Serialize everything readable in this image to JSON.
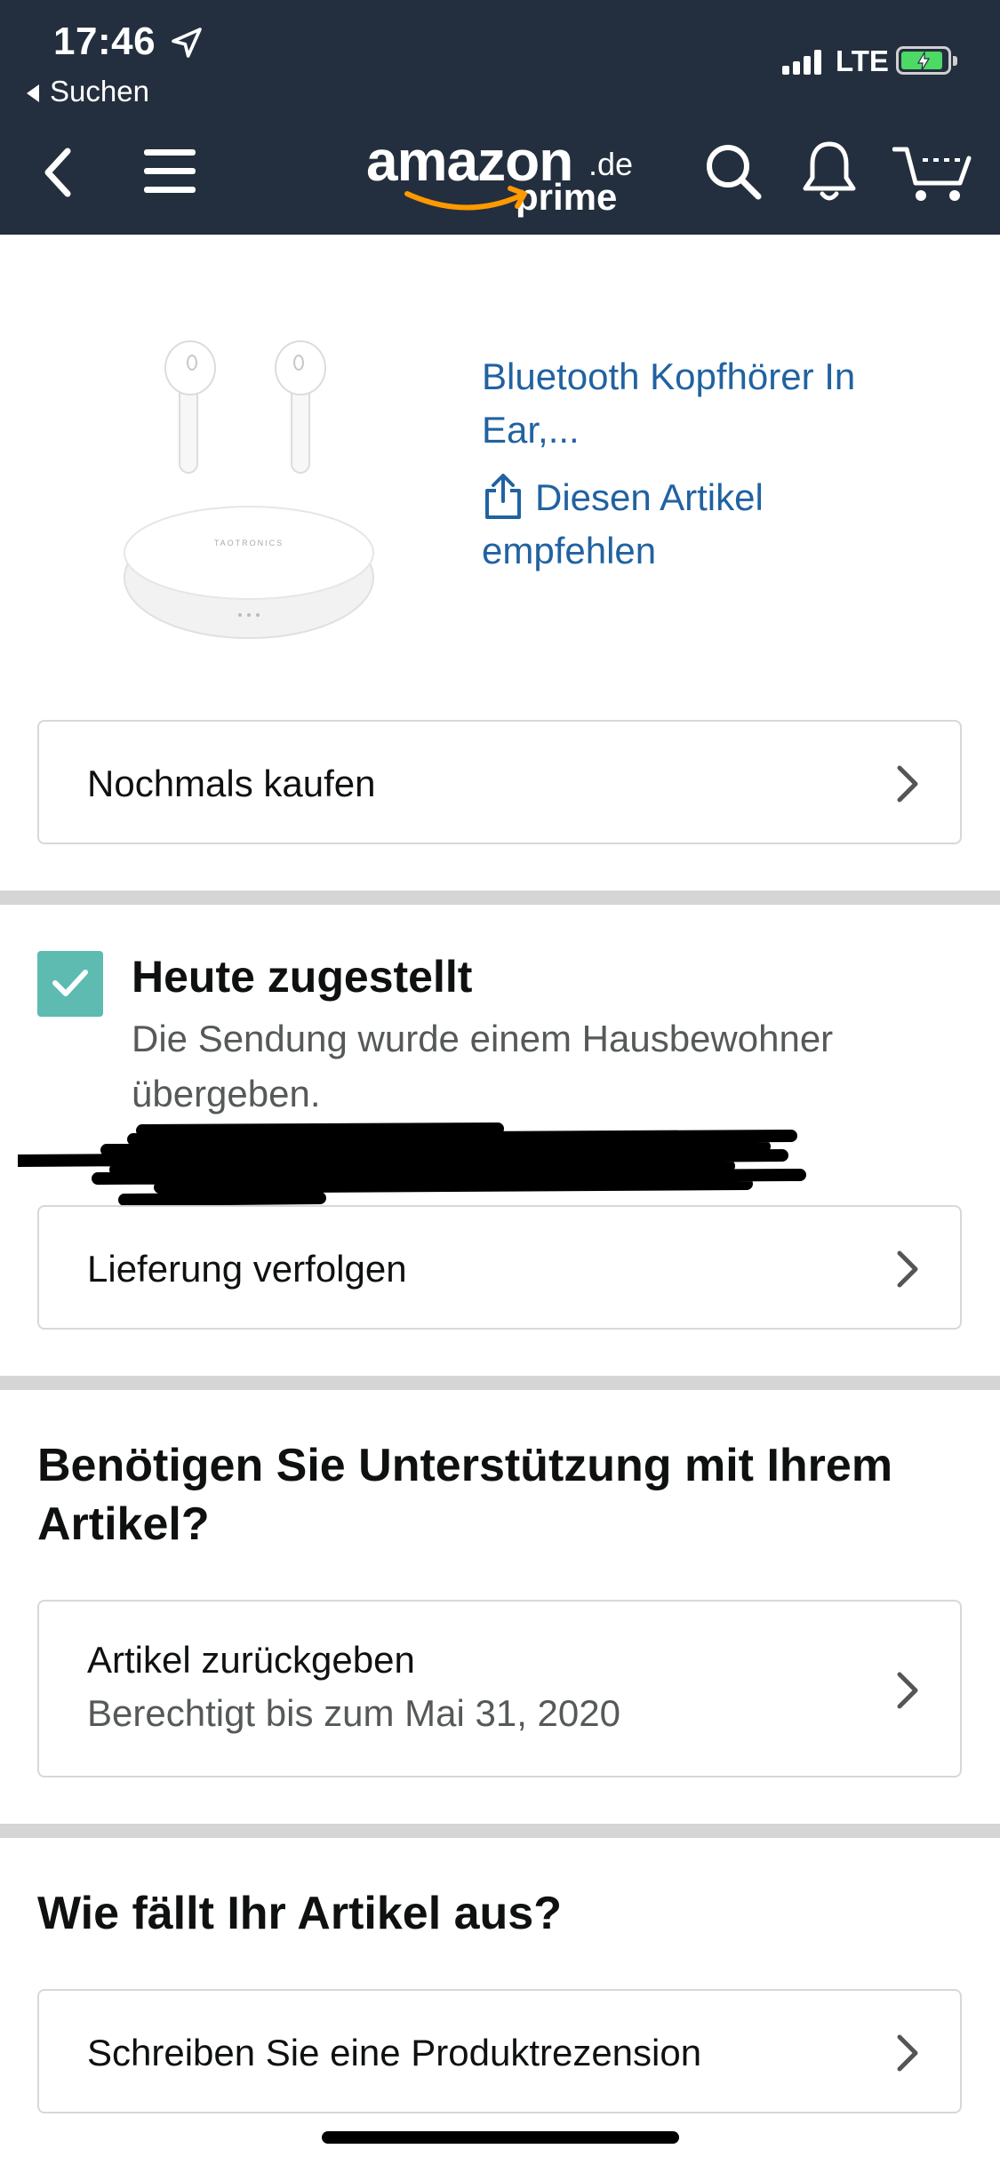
{
  "status_bar": {
    "time": "17:46",
    "back_to_app": "Suchen",
    "network": "LTE"
  },
  "nav": {
    "logo_text": "amazon",
    "logo_suffix": ".de",
    "logo_prime": "prime",
    "icons": [
      "back-icon",
      "menu-icon",
      "search-icon",
      "bell-icon",
      "cart-icon"
    ]
  },
  "product": {
    "title": "Bluetooth Kopfhörer In Ear,...",
    "recommend_label": "Diesen Artikel empfehlen",
    "buy_again_label": "Nochmals kaufen"
  },
  "delivery": {
    "status_title": "Heute zugestellt",
    "status_desc": "Die Sendung wurde einem Hausbewohner übergeben.",
    "track_label": "Lieferung verfolgen"
  },
  "support": {
    "heading": "Benötigen Sie Unterstützung mit Ihrem Artikel?",
    "return_label": "Artikel zurückgeben",
    "return_sub": "Berechtigt bis zum Mai 31, 2020"
  },
  "review": {
    "heading": "Wie fällt Ihr Artikel aus?",
    "write_review_label": "Schreiben Sie eine Produktrezension"
  },
  "colors": {
    "header_bg": "#232f3e",
    "link": "#2162a1",
    "check_teal": "#5dbbb1",
    "smile_orange": "#f90"
  }
}
